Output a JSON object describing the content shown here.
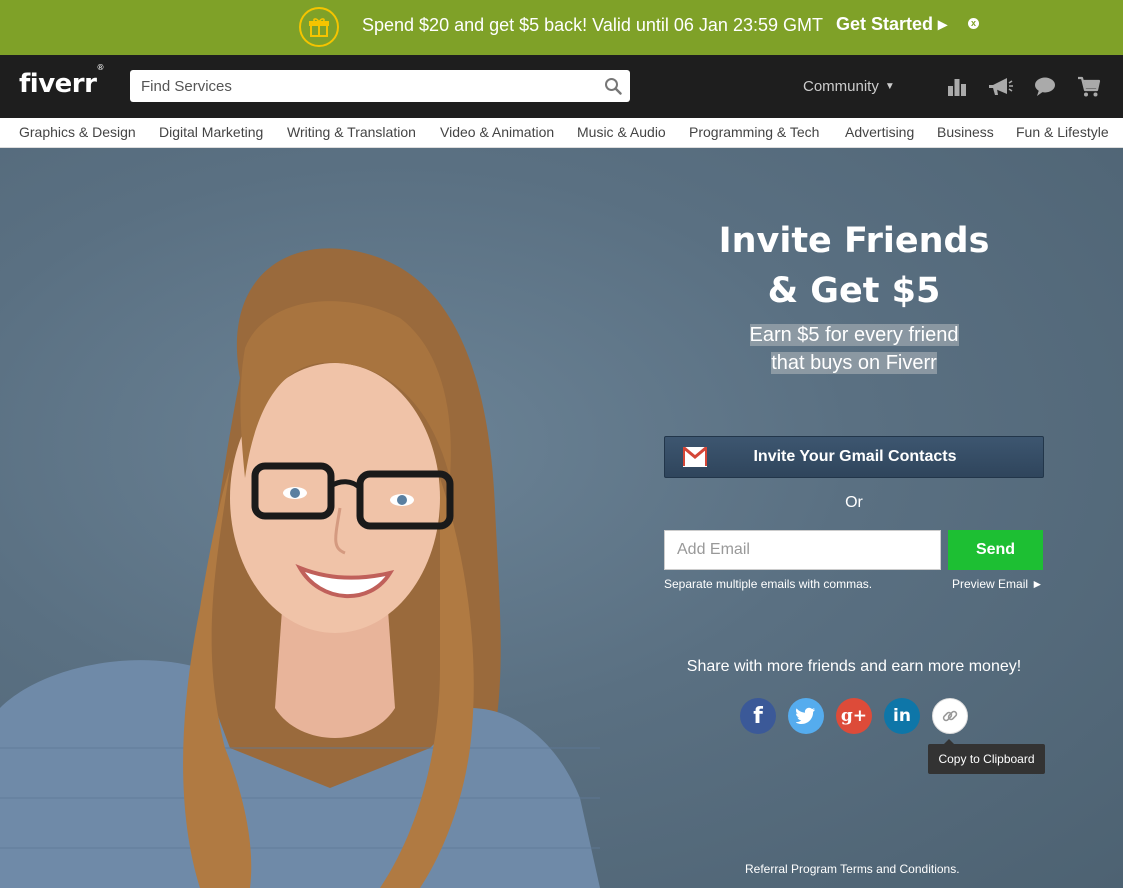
{
  "promo": {
    "text": "Spend $20 and get $5 back! Valid until 06 Jan 23:59 GMT",
    "cta": "Get Started ▸",
    "icon": "gift-icon",
    "close": "x"
  },
  "header": {
    "logo": "fiverr",
    "logo_mark": "®",
    "search_placeholder": "Find Services",
    "community": "Community",
    "icons": [
      "bar-chart-icon",
      "megaphone-icon",
      "chat-bubble-icon",
      "cart-icon"
    ]
  },
  "categories": [
    "Graphics & Design",
    "Digital Marketing",
    "Writing & Translation",
    "Video & Animation",
    "Music & Audio",
    "Programming & Tech",
    "Advertising",
    "Business",
    "Fun & Lifestyle"
  ],
  "hero": {
    "title_line1": "Invite Friends",
    "title_line2": "& Get $5",
    "sub_line1": "Earn $5 for every friend",
    "sub_line2": "that buys on Fiverr",
    "gmail_button": "Invite Your Gmail Contacts",
    "or": "Or",
    "email_placeholder": "Add Email",
    "send": "Send",
    "hint": "Separate multiple emails with commas.",
    "preview": "Preview Email ►",
    "share_text": "Share with more friends and earn more money!",
    "social": {
      "facebook": "f",
      "google": "g+",
      "linkedin": "in"
    },
    "tooltip": "Copy to Clipboard",
    "terms": "Referral Program Terms and Conditions."
  },
  "colors": {
    "promo_bg": "#7fa128",
    "header_bg": "#1e1e1e",
    "send_green": "#1dbf33",
    "gmail_btn": "#2f455c",
    "hero_bg": "#5a7082"
  }
}
